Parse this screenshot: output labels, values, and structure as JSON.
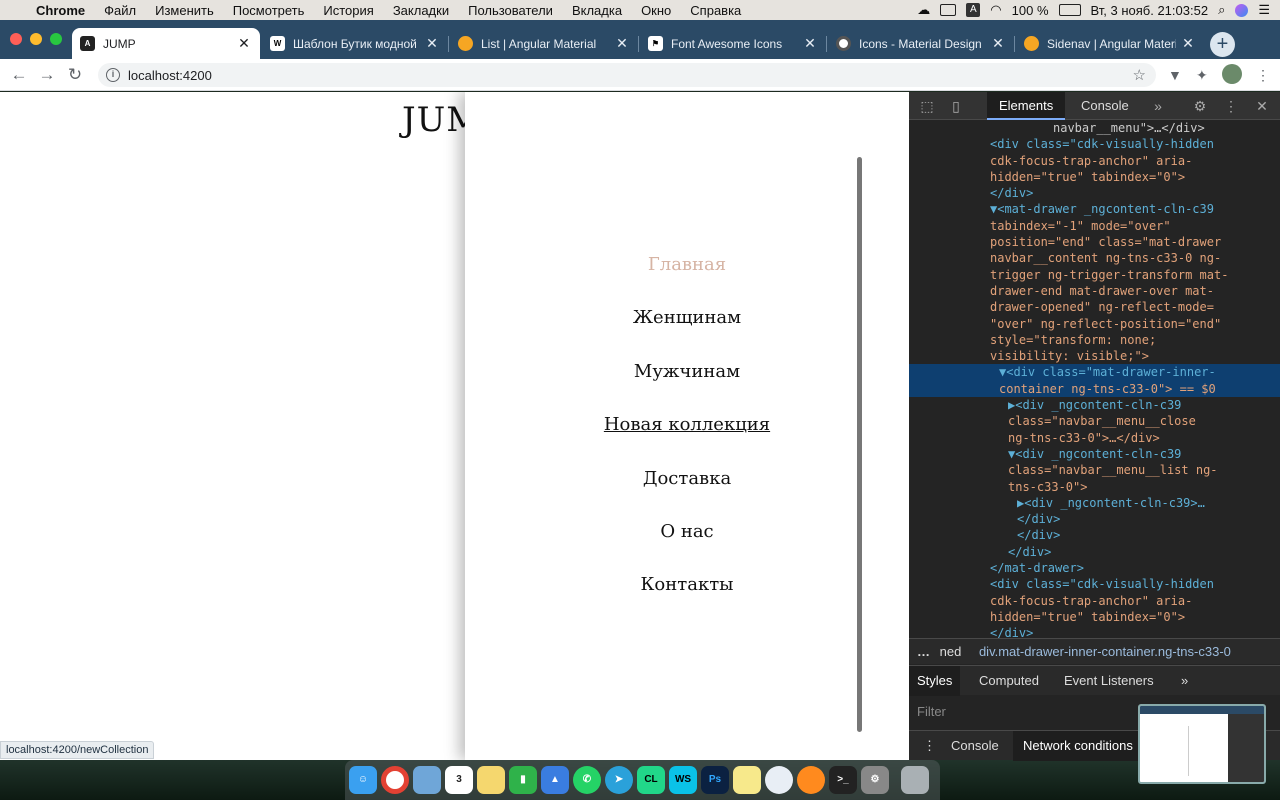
{
  "mac_menu": {
    "app_name": "Chrome",
    "items": [
      "Файл",
      "Изменить",
      "Посмотреть",
      "История",
      "Закладки",
      "Пользователи",
      "Вкладка",
      "Окно",
      "Справка"
    ],
    "battery": "100 %",
    "datetime": "Вт, 3 нояб. 21:03:52"
  },
  "tabs": [
    {
      "title": "JUMP",
      "icon": "angular-icon",
      "active": true
    },
    {
      "title": "Шаблон Бутик модной од",
      "icon": "wix-icon"
    },
    {
      "title": "List | Angular Material",
      "icon": "angular-material-icon"
    },
    {
      "title": "Font Awesome Icons",
      "icon": "font-awesome-icon"
    },
    {
      "title": "Icons - Material Design",
      "icon": "material-design-icon"
    },
    {
      "title": "Sidenav | Angular Material",
      "icon": "angular-material-icon"
    }
  ],
  "address": {
    "url": "localhost:4200"
  },
  "page": {
    "brand": "JUMP",
    "menu": [
      {
        "label": "Главная",
        "state": "active"
      },
      {
        "label": "Женщинам"
      },
      {
        "label": "Мужчинам"
      },
      {
        "label": "Новая коллекция",
        "state": "hovered"
      },
      {
        "label": "Доставка"
      },
      {
        "label": "О нас"
      },
      {
        "label": "Контакты"
      }
    ],
    "status_url": "localhost:4200/newCollection"
  },
  "devtools": {
    "tabs": [
      "Elements",
      "Console"
    ],
    "code_lines": [
      "navbar__menu\">…</div>",
      "<div class=\"cdk-visually-hidden",
      "cdk-focus-trap-anchor\" aria-",
      "hidden=\"true\" tabindex=\"0\">",
      "</div>",
      "▼<mat-drawer _ngcontent-cln-c39",
      "tabindex=\"-1\" mode=\"over\"",
      "position=\"end\" class=\"mat-drawer",
      "navbar__content ng-tns-c33-0 ng-",
      "trigger ng-trigger-transform mat-",
      "drawer-end mat-drawer-over mat-",
      "drawer-opened\" ng-reflect-mode=",
      "\"over\" ng-reflect-position=\"end\"",
      "style=\"transform: none;",
      "visibility: visible;\">",
      "▼<div class=\"mat-drawer-inner-",
      "container ng-tns-c33-0\"> == $0",
      "▶<div _ngcontent-cln-c39",
      "class=\"navbar__menu__close",
      "ng-tns-c33-0\">…</div>",
      "▼<div _ngcontent-cln-c39",
      "class=\"navbar__menu__list ng-",
      "tns-c33-0\">",
      "▶<div _ngcontent-cln-c39>…",
      "</div>",
      "</div>",
      "</div>",
      "</mat-drawer>",
      "<div class=\"cdk-visually-hidden",
      "cdk-focus-trap-anchor\" aria-",
      "hidden=\"true\" tabindex=\"0\">",
      "</div>"
    ],
    "breadcrumb": {
      "prefix": "…",
      "item1": "ned",
      "item2": "div.mat-drawer-inner-container.ng-tns-c33-0"
    },
    "style_tabs": [
      "Styles",
      "Computed",
      "Event Listeners"
    ],
    "filter_placeholder": "Filter",
    "drawer_tabs": [
      "Console",
      "Network conditions"
    ]
  },
  "dock_apps": [
    "finder-icon",
    "chrome-icon",
    "preview-icon",
    "calendar-icon",
    "notes-icon",
    "numbers-icon",
    "keynote-icon",
    "whatsapp-icon",
    "telegram-icon",
    "clion-icon",
    "webstorm-icon",
    "photoshop-icon",
    "stickies-icon",
    "safari-icon",
    "sublime-icon",
    "terminal-icon",
    "system-preferences-icon",
    "trash-icon"
  ],
  "dock_calendar_day": "3",
  "colors": {
    "menu_active": "#d6b4a4",
    "tab_strip": "#2b4a66",
    "devtools_bg": "#242424"
  }
}
